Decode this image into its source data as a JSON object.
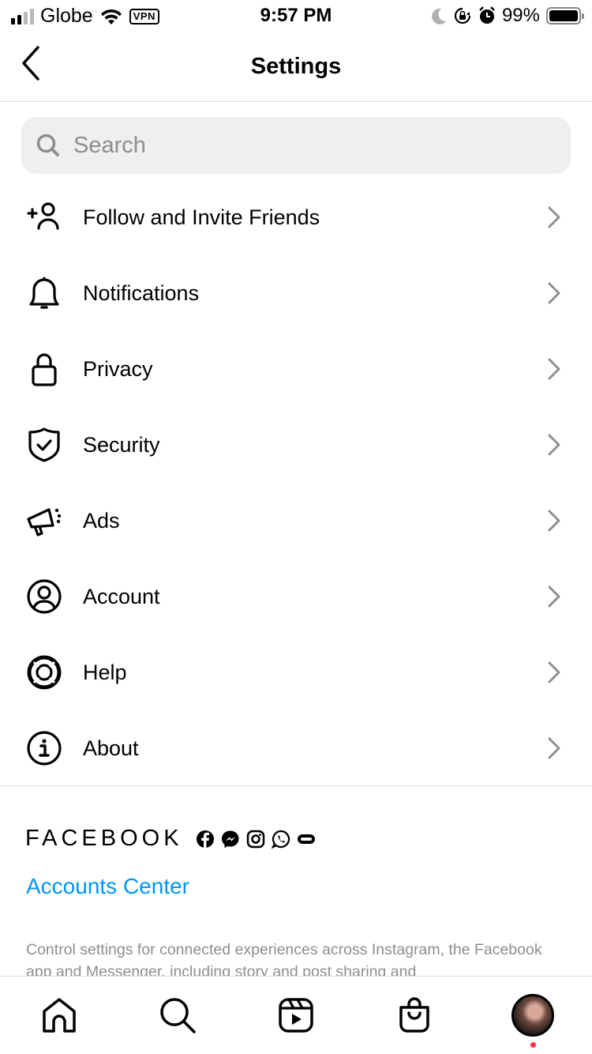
{
  "status_bar": {
    "carrier": "Globe",
    "vpn_label": "VPN",
    "time": "9:57 PM",
    "battery_percent": "99%",
    "icons": [
      "signal-icon",
      "wifi-icon",
      "vpn-badge",
      "moon-icon",
      "orientation-lock-icon",
      "alarm-icon",
      "battery-icon"
    ]
  },
  "header": {
    "title": "Settings",
    "back_icon": "chevron-left-icon"
  },
  "search": {
    "placeholder": "Search",
    "value": "",
    "icon": "search-icon"
  },
  "menu": {
    "items": [
      {
        "label": "Follow and Invite Friends",
        "icon": "add-person-icon"
      },
      {
        "label": "Notifications",
        "icon": "bell-icon"
      },
      {
        "label": "Privacy",
        "icon": "lock-icon"
      },
      {
        "label": "Security",
        "icon": "shield-check-icon"
      },
      {
        "label": "Ads",
        "icon": "megaphone-icon"
      },
      {
        "label": "Account",
        "icon": "user-circle-icon"
      },
      {
        "label": "Help",
        "icon": "lifebuoy-icon"
      },
      {
        "label": "About",
        "icon": "info-icon"
      }
    ]
  },
  "facebook": {
    "wordmark": "FACEBOOK",
    "app_icons": [
      "facebook-icon",
      "messenger-icon",
      "instagram-icon",
      "whatsapp-icon",
      "oculus-icon"
    ],
    "accounts_center_label": "Accounts Center",
    "description": "Control settings for connected experiences across Instagram, the Facebook app and Messenger, including story and post sharing and",
    "link_color": "#0095f6"
  },
  "tab_bar": {
    "tabs": [
      "home-icon",
      "search-icon",
      "reels-icon",
      "shop-icon",
      "profile-avatar"
    ],
    "notification_dot_color": "#ff3040"
  }
}
